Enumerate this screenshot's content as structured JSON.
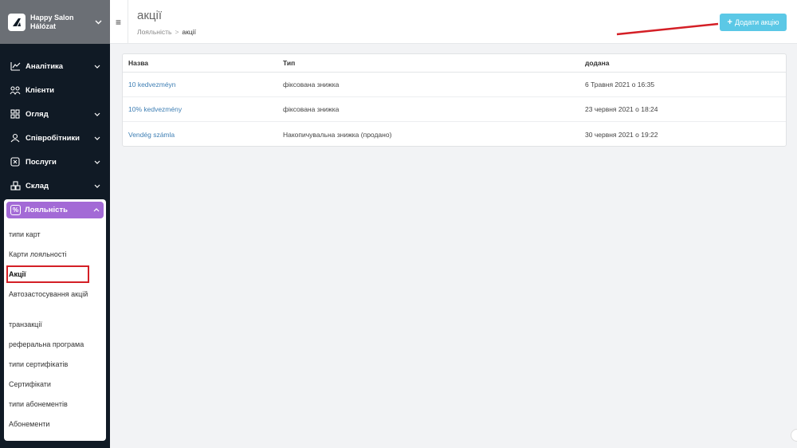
{
  "brand": {
    "line1": "Happy Salon",
    "line2": "Hálózat"
  },
  "sidebar": {
    "items": [
      {
        "label": "Аналітика"
      },
      {
        "label": "Клієнти"
      },
      {
        "label": "Огляд"
      },
      {
        "label": "Співробітники"
      },
      {
        "label": "Послуги"
      },
      {
        "label": "Склад"
      }
    ],
    "loyalty": {
      "label": "Лояльність",
      "sub": [
        "типи карт",
        "Карти лояльності",
        "Акції",
        "Автозастосування акцій",
        "транзакції",
        "реферальна програма",
        "типи сертифікатів",
        "Сертифікати",
        "типи абонементів",
        "Абонементи"
      ]
    }
  },
  "header": {
    "title": "акції",
    "breadcrumb": {
      "parent": "Лояльність",
      "separator": ">",
      "current": "акції"
    },
    "add_button": "Додати акцію"
  },
  "table": {
    "columns": [
      "Назва",
      "Тип",
      "додана"
    ],
    "rows": [
      {
        "name": "10 kedvezméyn",
        "type": "фіксована знижка",
        "added": "6 Травня 2021 о 16:35"
      },
      {
        "name": "10% kedvezmény",
        "type": "фіксована знижка",
        "added": "23 червня 2021 о 18:24"
      },
      {
        "name": "Vendég számla",
        "type": "Накопичувальна знижка (продано)",
        "added": "30 червня 2021 о 19:22"
      }
    ]
  },
  "colors": {
    "sidebar": "#101a25",
    "brand_bg": "#6b6f75",
    "active_purple": "#a36ad6",
    "button": "#5bc8e6",
    "link": "#3f7fb4",
    "annotation_red": "#d41f26"
  }
}
